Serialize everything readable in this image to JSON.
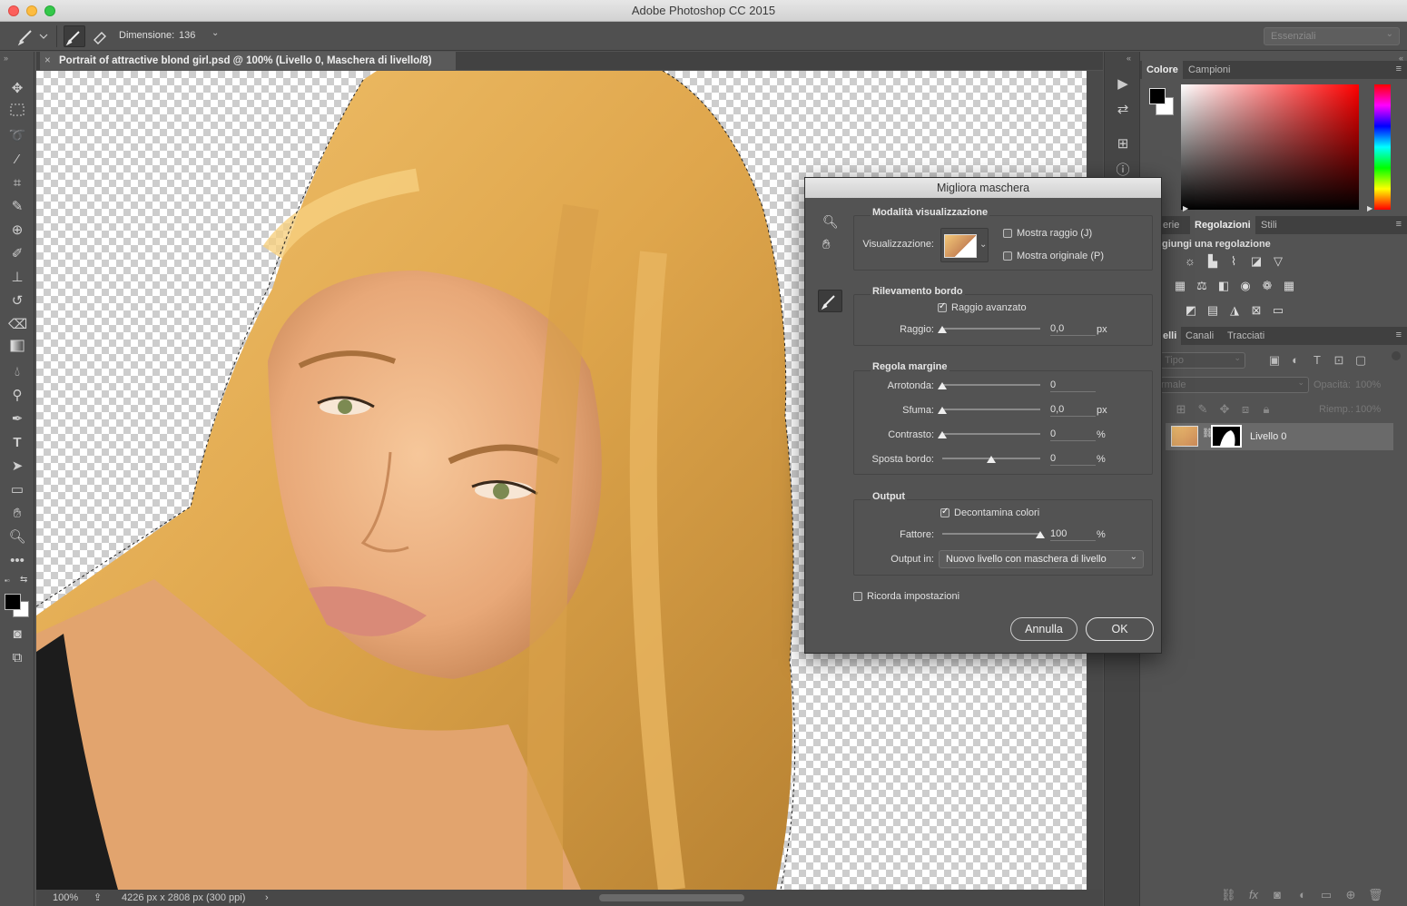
{
  "app": {
    "window_title": "Adobe Photoshop CC 2015"
  },
  "options_bar": {
    "size_label": "Dimensione:",
    "size_value": "136",
    "workspace": "Essenziali"
  },
  "document": {
    "tab_title": "Portrait of attractive blond girl.psd @ 100% (Livello 0, Maschera di livello/8)",
    "close_glyph": "×"
  },
  "status": {
    "zoom": "100%",
    "doc_info": "4226 px x 2808 px (300 ppi)",
    "arrow": "›"
  },
  "color_panel": {
    "tabs": [
      "Colore",
      "Campioni"
    ],
    "foreground": "#000000",
    "background": "#ffffff"
  },
  "adjust_panel": {
    "tabs": [
      "erie",
      "Regolazioni",
      "Stili"
    ],
    "hint": "giungi una regolazione"
  },
  "layers_panel": {
    "tabs": [
      "elli",
      "Canali",
      "Tracciati"
    ],
    "filter_kind": "Tipo",
    "blend_mode": "rmale",
    "opacity_label": "Opacità:",
    "opacity_value": "100%",
    "fill_label": "Riemp.:",
    "fill_value": "100%",
    "layer_name": "Livello 0"
  },
  "dialog": {
    "title": "Migliora maschera",
    "view_mode": {
      "title": "Modalità visualizzazione",
      "view_label": "Visualizzazione:",
      "show_radius": "Mostra raggio (J)",
      "show_original": "Mostra originale (P)"
    },
    "edge_detection": {
      "title": "Rilevamento bordo",
      "smart_radius": "Raggio avanzato",
      "smart_radius_checked": true,
      "radius_label": "Raggio:",
      "radius_value": "0,0",
      "radius_unit": "px",
      "radius_slider_fraction": 0.0
    },
    "adjust_edge": {
      "title": "Regola margine",
      "smooth_label": "Arrotonda:",
      "smooth_value": "0",
      "smooth_fraction": 0.0,
      "feather_label": "Sfuma:",
      "feather_value": "0,0",
      "feather_unit": "px",
      "feather_fraction": 0.0,
      "contrast_label": "Contrasto:",
      "contrast_value": "0",
      "contrast_unit": "%",
      "contrast_fraction": 0.0,
      "shift_label": "Sposta bordo:",
      "shift_value": "0",
      "shift_unit": "%",
      "shift_fraction": 0.5
    },
    "output": {
      "title": "Output",
      "decontaminate": "Decontamina colori",
      "decontaminate_checked": true,
      "amount_label": "Fattore:",
      "amount_value": "100",
      "amount_unit": "%",
      "amount_fraction": 1.0,
      "output_to_label": "Output in:",
      "output_to_value": "Nuovo livello con maschera di livello"
    },
    "remember": "Ricorda impostazioni",
    "remember_checked": false,
    "cancel": "Annulla",
    "ok": "OK"
  }
}
